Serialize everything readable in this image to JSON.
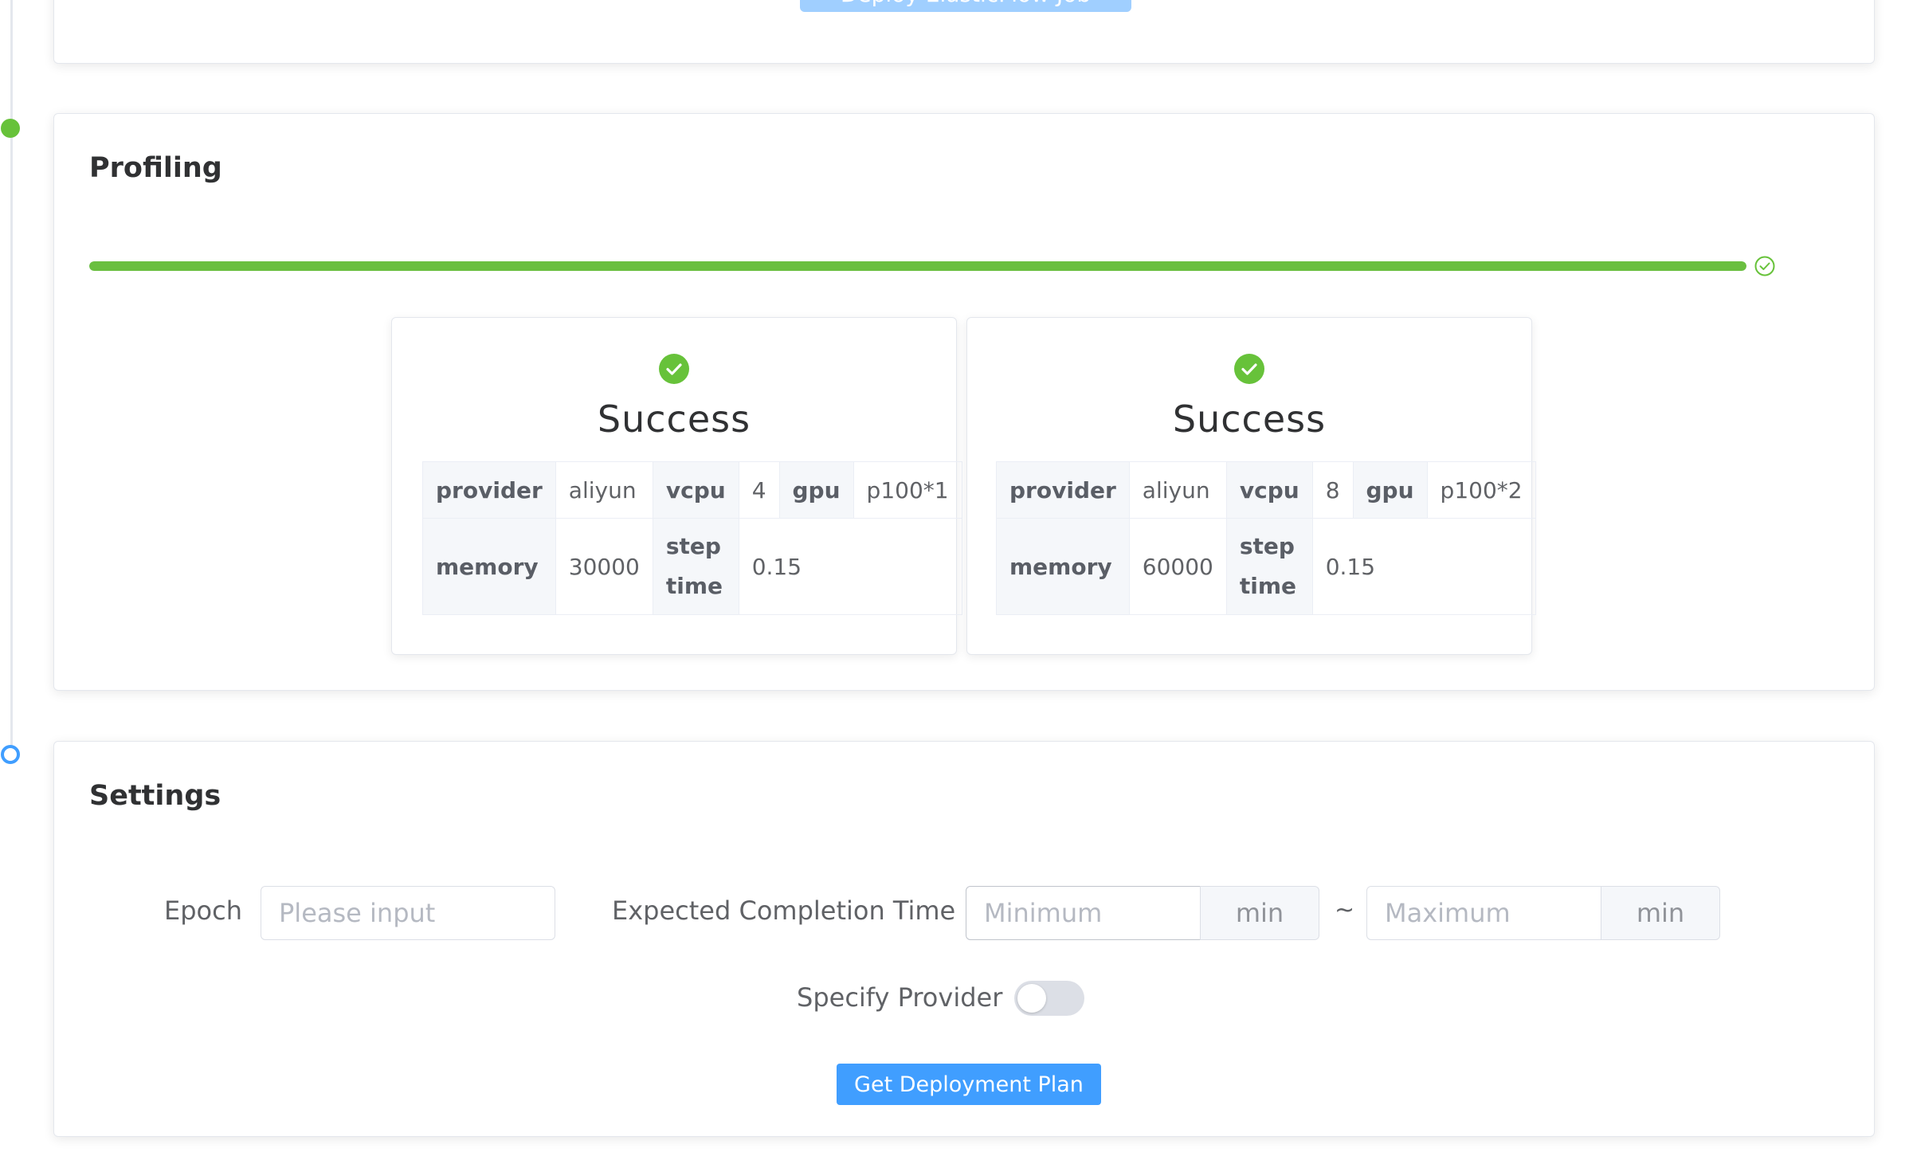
{
  "top_card": {
    "deploy_button": "Deploy ElasticFlow Job"
  },
  "profiling": {
    "title": "Profiling",
    "progress_percent": 100,
    "results": [
      {
        "status": "Success",
        "provider_label": "provider",
        "provider": "aliyun",
        "vcpu_label": "vcpu",
        "vcpu": "4",
        "gpu_label": "gpu",
        "gpu": "p100*1",
        "memory_label": "memory",
        "memory": "30000",
        "step_time_label": "step time",
        "step_time": "0.15"
      },
      {
        "status": "Success",
        "provider_label": "provider",
        "provider": "aliyun",
        "vcpu_label": "vcpu",
        "vcpu": "8",
        "gpu_label": "gpu",
        "gpu": "p100*2",
        "memory_label": "memory",
        "memory": "60000",
        "step_time_label": "step time",
        "step_time": "0.15"
      }
    ]
  },
  "settings": {
    "title": "Settings",
    "epoch_label": "Epoch",
    "epoch_placeholder": "Please input",
    "completion_label": "Expected Completion Time",
    "min_placeholder": "Minimum",
    "max_placeholder": "Maximum",
    "unit": "min",
    "separator": "~",
    "provider_toggle_label": "Specify Provider",
    "provider_toggle_on": false,
    "submit_button": "Get Deployment Plan"
  },
  "colors": {
    "success": "#67c23a",
    "primary": "#409eff",
    "progress": "#6abf40"
  }
}
